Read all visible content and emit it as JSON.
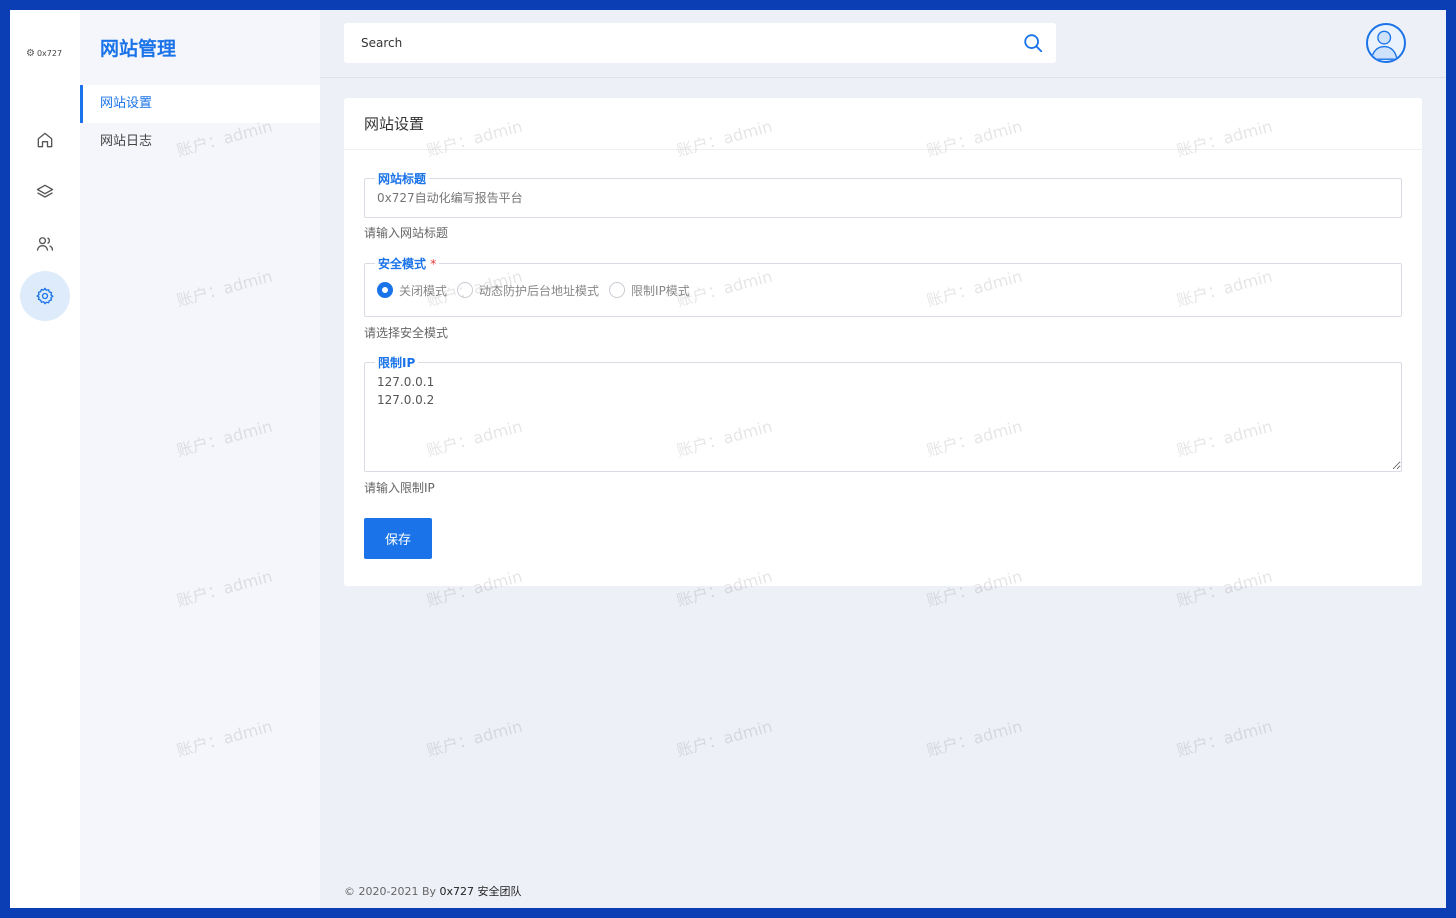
{
  "rail": {
    "logo_text": "0x727",
    "items": [
      {
        "icon": "home-icon",
        "active": false
      },
      {
        "icon": "layers-icon",
        "active": false
      },
      {
        "icon": "users-icon",
        "active": false
      },
      {
        "icon": "gear-icon",
        "active": true
      }
    ]
  },
  "subnav": {
    "title": "网站管理",
    "items": [
      {
        "label": "网站设置",
        "active": true
      },
      {
        "label": "网站日志",
        "active": false
      }
    ]
  },
  "header": {
    "search_placeholder": "Search"
  },
  "card": {
    "title": "网站设置",
    "site_title": {
      "legend": "网站标题",
      "placeholder": "0x727自动化编写报告平台",
      "help": "请输入网站标题"
    },
    "security_mode": {
      "legend": "安全模式",
      "required_mark": "*",
      "options": [
        {
          "label": "关闭模式",
          "checked": true
        },
        {
          "label": "动态防护后台地址模式",
          "checked": false
        },
        {
          "label": "限制IP模式",
          "checked": false
        }
      ],
      "help": "请选择安全模式"
    },
    "restrict_ip": {
      "legend": "限制IP",
      "value": "127.0.0.1\n127.0.0.2",
      "help": "请输入限制IP"
    },
    "save_label": "保存"
  },
  "footer": {
    "copyright": "© 2020-2021 By ",
    "team": "0x727 安全团队"
  },
  "watermark": "账户：admin",
  "colors": {
    "accent": "#1a73e8",
    "border_frame": "#0b3db5",
    "required": "#e53935"
  }
}
